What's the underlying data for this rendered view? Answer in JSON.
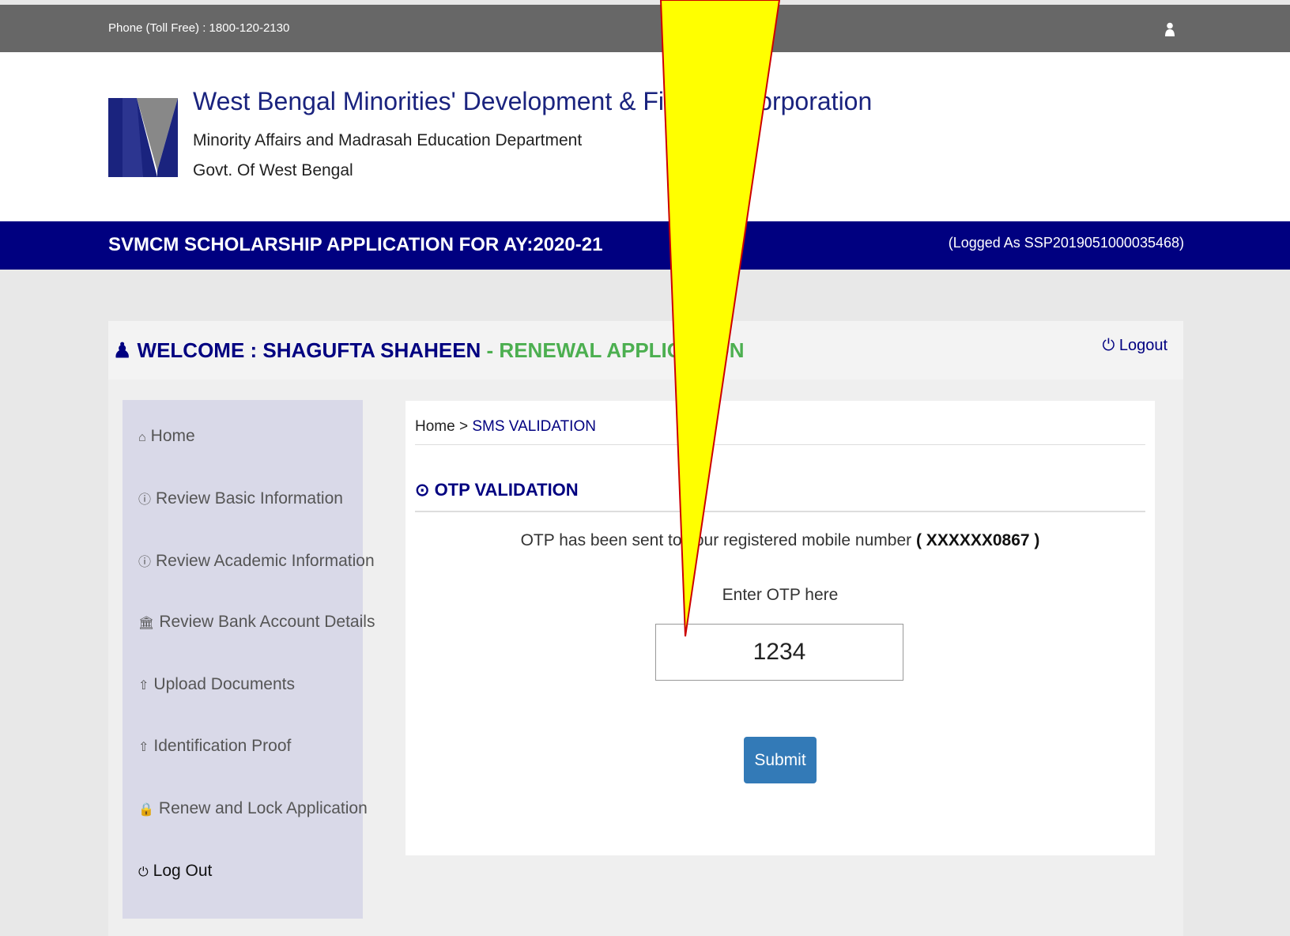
{
  "topbar": {
    "phone": "Phone (Toll Free) : 1800-120-2130",
    "user_icon": "user-icon"
  },
  "header": {
    "org_name": "West Bengal Minorities' Development & Finance Corporation",
    "dept": "Minority Affairs and Madrasah Education Department",
    "govt": "Govt. Of West Bengal"
  },
  "titlebar": {
    "title": "SVMCM SCHOLARSHIP APPLICATION FOR AY:2020-21",
    "logged_as": "(Logged As SSP2019051000035468)"
  },
  "welcome": {
    "prefix": "WELCOME : SHAGUFTA SHAHEEN",
    "suffix": "- RENEWAL APPLICATION",
    "logout": "Logout"
  },
  "sidebar": {
    "items": [
      {
        "label": "Home",
        "icon": "home-icon"
      },
      {
        "label": "Review Basic Information",
        "icon": "info-icon"
      },
      {
        "label": "Review Academic Information",
        "icon": "info-icon"
      },
      {
        "label": "Review Bank Account Details",
        "icon": "bank-icon"
      },
      {
        "label": "Upload Documents",
        "icon": "upload-icon"
      },
      {
        "label": "Identification Proof",
        "icon": "upload-icon"
      },
      {
        "label": "Renew and Lock Application",
        "icon": "lock-icon"
      },
      {
        "label": "Log Out",
        "icon": "power-icon"
      }
    ]
  },
  "main": {
    "breadcrumb_home": "Home",
    "breadcrumb_sep": ">",
    "breadcrumb_current": "SMS VALIDATION",
    "section_title": "OTP VALIDATION",
    "otp_msg": "OTP has been sent to your registered mobile number",
    "mobile_masked": "( XXXXXX0867 )",
    "enter_label": "Enter OTP here",
    "otp_value": "1234",
    "submit_label": "Submit"
  },
  "colors": {
    "topbar": "#676767",
    "titlebar": "#000080",
    "accent_green": "#4caf50",
    "button": "#337ab7",
    "callout_fill": "#ffff00",
    "callout_stroke": "#cc0000"
  }
}
